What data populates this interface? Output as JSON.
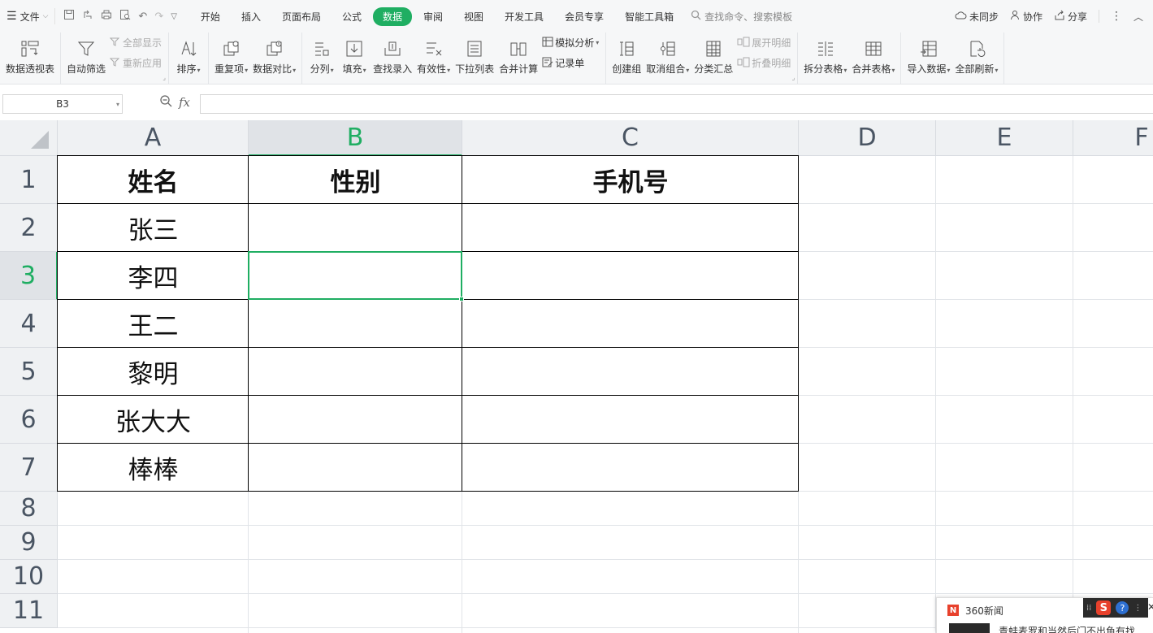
{
  "menubar": {
    "file_label": "文件",
    "tabs": [
      {
        "label": "开始",
        "active": false
      },
      {
        "label": "插入",
        "active": false
      },
      {
        "label": "页面布局",
        "active": false
      },
      {
        "label": "公式",
        "active": false
      },
      {
        "label": "数据",
        "active": true
      },
      {
        "label": "审阅",
        "active": false
      },
      {
        "label": "视图",
        "active": false
      },
      {
        "label": "开发工具",
        "active": false
      },
      {
        "label": "会员专享",
        "active": false
      },
      {
        "label": "智能工具箱",
        "active": false
      }
    ],
    "search_placeholder": "查找命令、搜索模板",
    "sync_label": "未同步",
    "collab_label": "协作",
    "share_label": "分享"
  },
  "ribbon": {
    "pivot": "数据透视表",
    "autofilter": "自动筛选",
    "show_all": "全部显示",
    "reapply": "重新应用",
    "sort": "排序",
    "duplicates": "重复项",
    "compare": "数据对比",
    "split": "分列",
    "fill": "填充",
    "lookup": "查找录入",
    "validity": "有效性",
    "dropdown": "下拉列表",
    "consolidate": "合并计算",
    "whatif": "模拟分析",
    "record": "记录单",
    "group": "创建组",
    "ungroup": "取消组合",
    "subtotal": "分类汇总",
    "expand": "展开明细",
    "collapse": "折叠明细",
    "split_table": "拆分表格",
    "merge_table": "合并表格",
    "import": "导入数据",
    "refresh": "全部刷新"
  },
  "formula": {
    "namebox": "B3",
    "fx": "fx",
    "value": ""
  },
  "grid": {
    "columns": [
      "A",
      "B",
      "C",
      "D",
      "E",
      "F"
    ],
    "rows": [
      "1",
      "2",
      "3",
      "4",
      "5",
      "6",
      "7",
      "8",
      "9",
      "10",
      "11"
    ],
    "selected_column": "B",
    "selected_row": "3",
    "header": [
      "姓名",
      "性别",
      "手机号"
    ],
    "names": [
      "张三",
      "李四",
      "王二",
      "黎明",
      "张大大",
      "棒棒"
    ]
  },
  "news": {
    "title": "360新闻",
    "headline": "青蛙麦罗和当然后门不出鱼有找"
  }
}
